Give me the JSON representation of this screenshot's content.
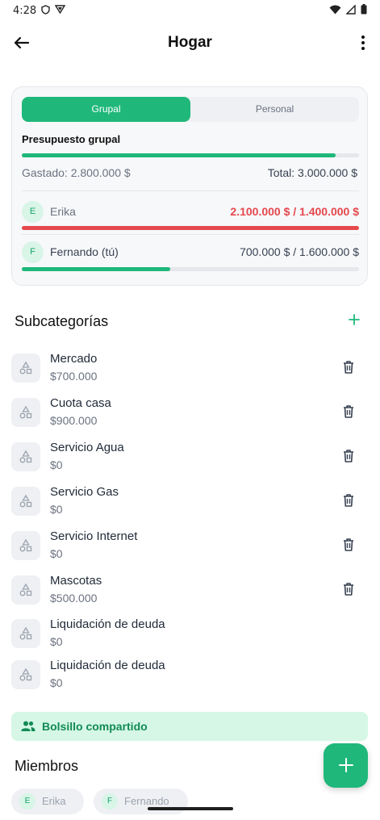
{
  "statusbar": {
    "time": "4:28"
  },
  "header": {
    "title": "Hogar"
  },
  "budget": {
    "tabs": [
      "Grupal",
      "Personal"
    ],
    "title": "Presupuesto grupal",
    "spent_label": "Gastado: 2.800.000 $",
    "total_label": "Total: 3.000.000 $",
    "progress": 0.93,
    "members": [
      {
        "initial": "E",
        "name": "Erika",
        "value": "2.100.000 $ / 1.400.000 $",
        "progress": 1.0,
        "color": "#e5484d"
      },
      {
        "initial": "F",
        "name": "Fernando (tú)",
        "value": "700.000 $ / 1.600.000 $",
        "progress": 0.44,
        "color": "#1fb87a"
      }
    ]
  },
  "subcategories": {
    "title": "Subcategorías",
    "items": [
      {
        "name": "Mercado",
        "value": "$700.000"
      },
      {
        "name": "Cuota casa",
        "value": "$900.000"
      },
      {
        "name": "Servicio Agua",
        "value": "$0"
      },
      {
        "name": "Servicio Gas",
        "value": "$0"
      },
      {
        "name": "Servicio Internet",
        "value": "$0"
      },
      {
        "name": "Mascotas",
        "value": "$500.000"
      },
      {
        "name": "Liquidación de deuda",
        "value": "$0"
      },
      {
        "name": "Liquidación de deuda",
        "value": "$0"
      }
    ]
  },
  "pocket": {
    "label": "Bolsillo compartido"
  },
  "members_section": {
    "title": "Miembros",
    "chips": [
      {
        "initial": "E",
        "name": "Erika"
      },
      {
        "initial": "F",
        "name": "Fernando"
      }
    ]
  },
  "colors": {
    "accent": "#1fb87a",
    "danger": "#e5484d"
  }
}
